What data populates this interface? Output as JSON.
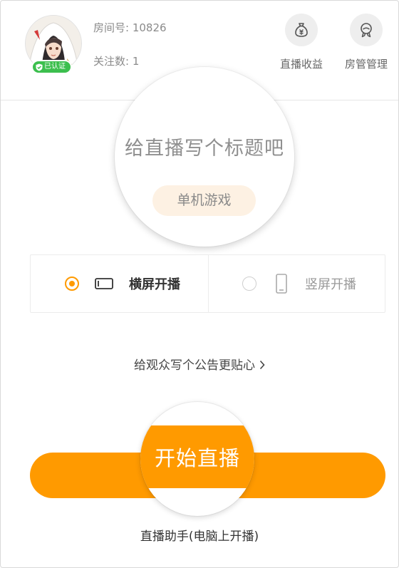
{
  "header": {
    "room_id": "房间号: 10826",
    "followers": "关注数: 1",
    "verified_label": "已认证"
  },
  "actions": {
    "income_label": "直播收益",
    "income_icon": "money-bag-icon",
    "manage_label": "房管管理",
    "manage_icon": "manager-badge-icon"
  },
  "title_section": {
    "placeholder": "给直播写个标题吧",
    "category": "单机游戏"
  },
  "orientation": {
    "landscape_label": "横屏开播",
    "portrait_label": "竖屏开播",
    "selected": "landscape"
  },
  "announcement": {
    "label": "给观众写个公告更贴心"
  },
  "start": {
    "label": "开始直播"
  },
  "pc_helper": {
    "label": "直播助手(电脑上开播)"
  },
  "colors": {
    "accent": "#ff9a00",
    "verified": "#3cbf4e",
    "category_bg": "#fdf1e3"
  }
}
